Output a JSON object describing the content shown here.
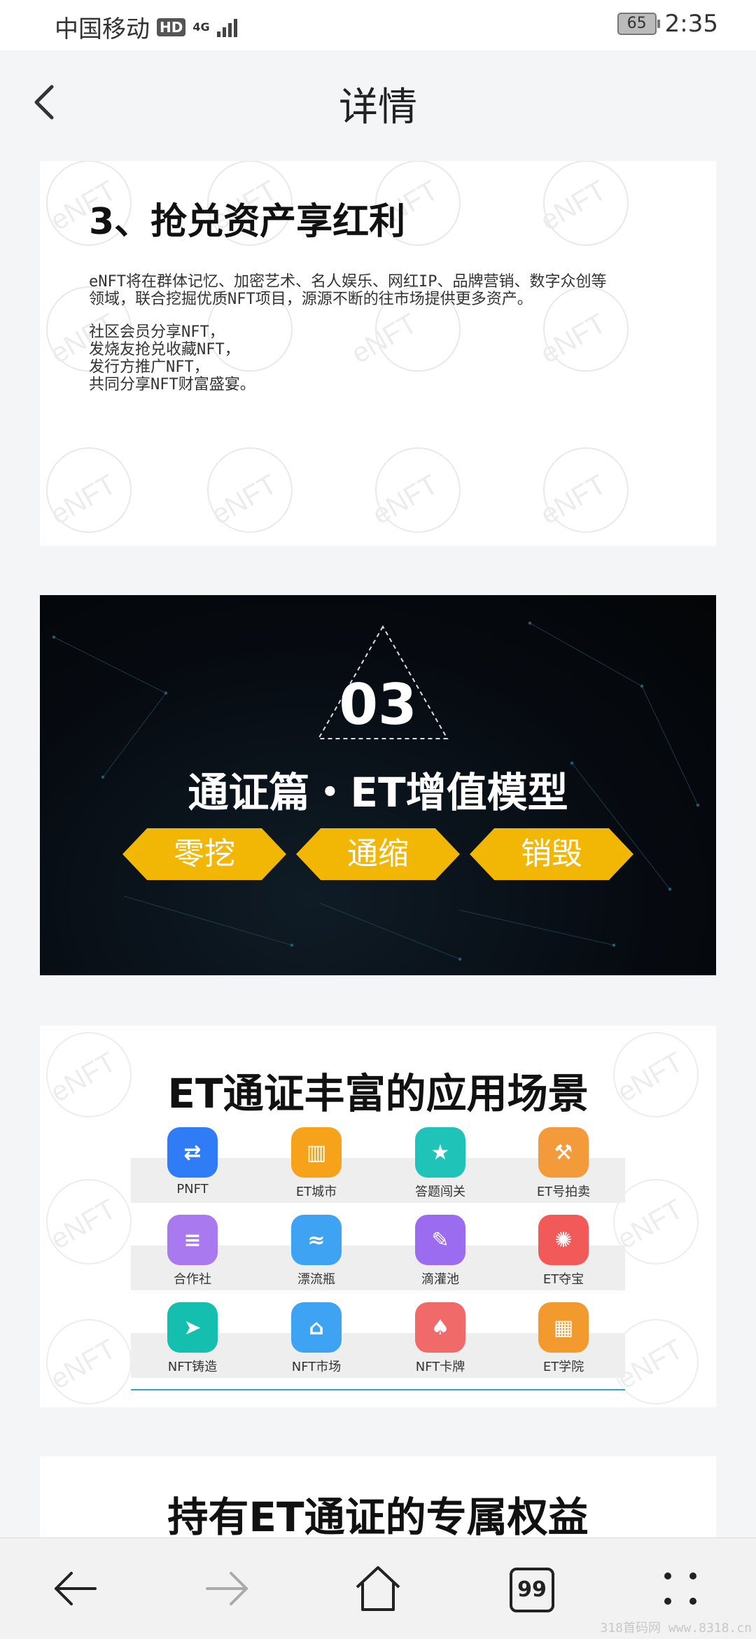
{
  "status": {
    "carrier": "中国移动",
    "hd": "HD",
    "net": "4G",
    "battery": "65",
    "time": "2:35"
  },
  "header": {
    "title": "详情"
  },
  "section3": {
    "heading": "3、抢兑资产享红利",
    "para1_line1": "eNFT将在群体记忆、加密艺术、名人娱乐、网红IP、品牌营销、数字众创等",
    "para1_line2": "领域，联合挖掘优质NFT项目，源源不断的往市场提供更多资产。",
    "lines": [
      "社区会员分享NFT，",
      "发烧友抢兑收藏NFT，",
      "发行方推广NFT，",
      "共同分享NFT财富盛宴。"
    ]
  },
  "banner": {
    "number": "03",
    "title": "通证篇・ET增值模型",
    "tags": [
      "零挖",
      "通缩",
      "销毁"
    ],
    "tag_color": "#f2b705"
  },
  "apps": {
    "title": "ET通证丰富的应用场景",
    "rows": [
      [
        {
          "label": "PNFT",
          "icon": "exchange-icon",
          "color": "#2f7cf6"
        },
        {
          "label": "ET城市",
          "icon": "city-icon",
          "color": "#f7a21b"
        },
        {
          "label": "答题闯关",
          "icon": "medal-icon",
          "color": "#1fc3b8"
        },
        {
          "label": "ET号拍卖",
          "icon": "gavel-icon",
          "color": "#f39a3a"
        }
      ],
      [
        {
          "label": "合作社",
          "icon": "hand-icon",
          "color": "#a879ef"
        },
        {
          "label": "漂流瓶",
          "icon": "bottle-icon",
          "color": "#3ea3f3"
        },
        {
          "label": "滴灌池",
          "icon": "pen-icon",
          "color": "#9b6cf0"
        },
        {
          "label": "ET夺宝",
          "icon": "treasure-icon",
          "color": "#f25a5a"
        }
      ],
      [
        {
          "label": "NFT铸造",
          "icon": "paper-plane-icon",
          "color": "#15bfb0"
        },
        {
          "label": "NFT市场",
          "icon": "shop-icon",
          "color": "#3ea3f3"
        },
        {
          "label": "NFT卡牌",
          "icon": "cards-icon",
          "color": "#f06a6a"
        },
        {
          "label": "ET学院",
          "icon": "academy-icon",
          "color": "#f29a2e"
        }
      ]
    ]
  },
  "section4": {
    "heading": "持有ET通证的专属权益"
  },
  "watermark": "eNFT",
  "nav": {
    "tabs_count": "99"
  },
  "footer": "318首码网 www.8318.cn"
}
